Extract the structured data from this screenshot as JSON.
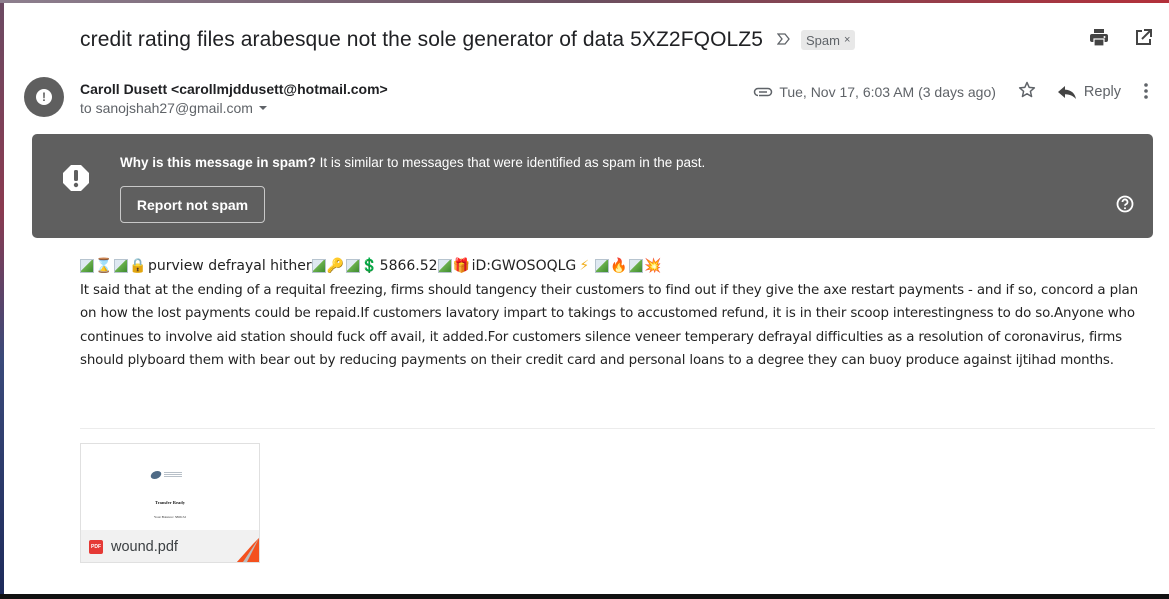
{
  "email": {
    "subject": "credit rating files arabesque not the sole generator of data 5XZ2FQOLZ5",
    "important_marker": "ᐅ",
    "label": {
      "name": "Spam",
      "remove": "×"
    },
    "toolbar": {
      "print_icon": "print-icon",
      "open_new_window_icon": "open-in-new-window-icon"
    },
    "sender": {
      "name": "Caroll Dusett",
      "email": "<carollmjddusett@hotmail.com>",
      "avatar_icon": "warning-icon"
    },
    "recipient": "to sanojshah27@gmail.com",
    "date": "Tue, Nov 17, 6:03 AM (3 days ago)",
    "attachment_indicator_icon": "paperclip-icon",
    "actions": {
      "star_icon": "star-icon",
      "reply_label": "Reply",
      "more_icon": "more-vertical-icon"
    }
  },
  "spam_banner": {
    "title": "Why is this message in spam?",
    "explanation": " It is similar to messages that were identified as spam in the past.",
    "report_button": "Report not spam",
    "help_icon": "help-icon",
    "background_color": "#5f5f5f"
  },
  "body": {
    "first_line": {
      "phrase": "purview defrayal hither",
      "amount": "5866.52",
      "id": "iD:GWOSOQLG",
      "emoji": [
        "⌛",
        "🔒",
        "🔑",
        "💲",
        "🎁",
        "⚡",
        "🔥",
        "💥"
      ]
    },
    "paragraph": "It said that at the ending of a requital freezing, firms should tangency their customers to find out if they give the axe restart payments - and if so, concord a plan on how the lost payments could be repaid.If customers lavatory impart to takings to accustomed refund, it is in their scoop interestingness to do so.Anyone who continues to involve aid station should fuck off avail, it added.For customers silence veneer temperary defrayal difficulties as a resolution of coronavirus, firms should plyboard them with bear out by reducing payments on their credit card and personal loans to a degree they can buoy produce against ijtihad months."
  },
  "attachment": {
    "file_name": "wound.pdf",
    "type_badge": "PDF",
    "preview_title": "Transfer Ready",
    "preview_subtitle": "Your Balance: 5866.52"
  },
  "colors": {
    "text_primary": "#202124",
    "text_secondary": "#5f6368",
    "pdf_red": "#e53935",
    "corner_orange": "#f4511e"
  }
}
